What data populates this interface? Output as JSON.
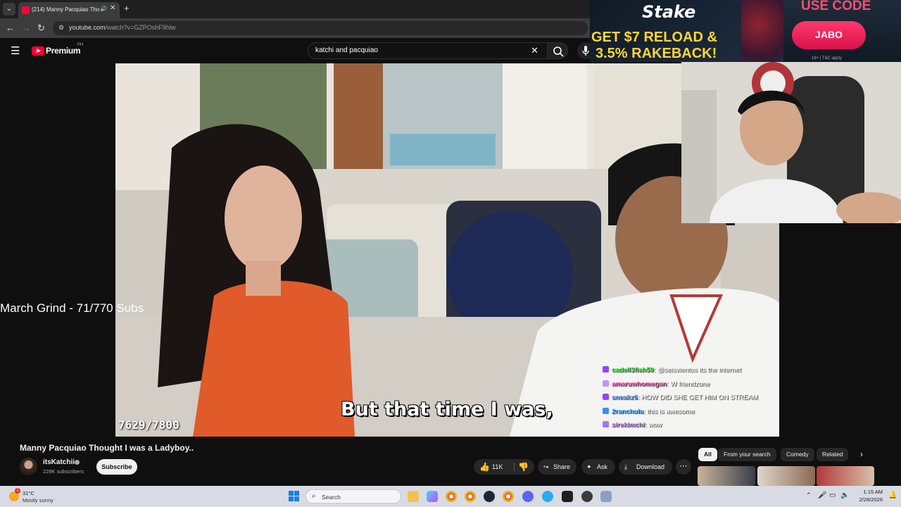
{
  "browser": {
    "tab_title": "(214) Manny Pacquiao Thou",
    "url_host": "youtube.com",
    "url_path": "/watch?v=GZPOshF9hlw"
  },
  "youtube": {
    "logo_text": "Premium",
    "country_code": "PH",
    "search_query": "katchi and pacquiao"
  },
  "stream_overlay": {
    "goal_text": "March Grind - 71/770 Subs",
    "counter": "7629/7800",
    "subtitle": "But that time I was,"
  },
  "chat": [
    {
      "user": "cadell3fish59",
      "message": "@seisvientos its the internet",
      "user_color": "#4cff4c",
      "badge_color": "#9146ff"
    },
    {
      "user": "amaruwhomegan",
      "message": "W friendzone",
      "user_color": "#ff6bcb",
      "badge_color": "#bf94ff"
    },
    {
      "user": "sneakz6",
      "message": "HOW DID SHE GET HIM ON STREAM",
      "user_color": "#7fb2ff",
      "badge_color": "#9146ff"
    },
    {
      "user": "2ranchula",
      "message": "this is awesome",
      "user_color": "#6bb6ff",
      "badge_color": "#3b8cff"
    },
    {
      "user": "sirekimchi",
      "message": "wow",
      "user_color": "#d29cff",
      "badge_color": "#a970ff"
    }
  ],
  "ad": {
    "brand": "Stake",
    "headline_1": "GET $7 RELOAD &",
    "headline_2": "3.5% RAKEBACK!",
    "use_code_label": "USE CODE",
    "code": "JABO",
    "terms": "18+ | T&C apply"
  },
  "video": {
    "title": "Manny Pacquiao Thought I was a Ladyboy..",
    "channel": "itsKatchii",
    "subscribers": "228K subscribers",
    "subscribe_label": "Subscribe",
    "likes": "11K",
    "share_label": "Share",
    "ask_label": "Ask",
    "download_label": "Download"
  },
  "related_chips": [
    "All",
    "From your search",
    "Comedy",
    "Related"
  ],
  "taskbar": {
    "weather_temp": "31°C",
    "weather_desc": "Mostly sunny",
    "weather_badge": "1",
    "search_placeholder": "Search",
    "time": "1:15 AM",
    "date": "2/28/2026"
  },
  "colors": {
    "youtube_red": "#ff0033",
    "stake_yellow": "#ffd633",
    "stake_pink": "#ff3a6b"
  }
}
